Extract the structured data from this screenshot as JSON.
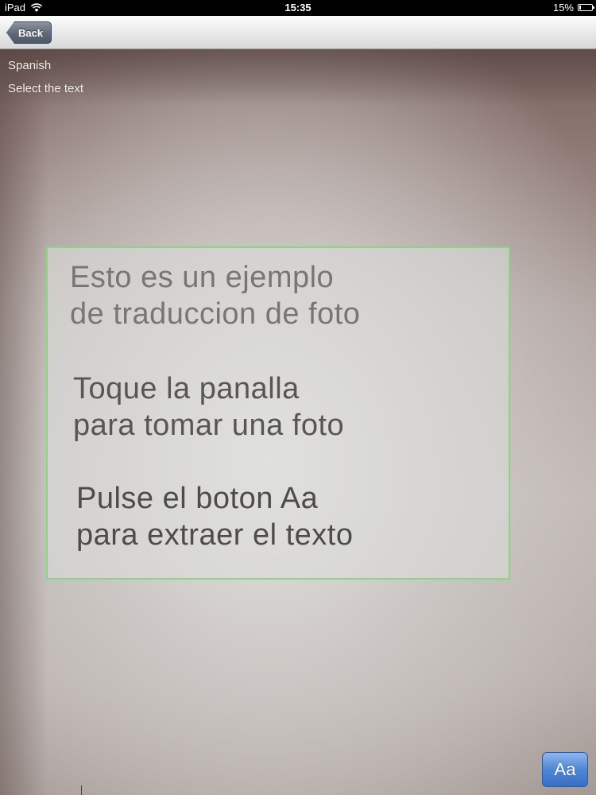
{
  "status_bar": {
    "carrier": "iPad",
    "time": "15:35",
    "battery_percent": "15%",
    "battery_level": 0.15,
    "wifi_icon": "wifi-icon"
  },
  "nav_bar": {
    "back_label": "Back"
  },
  "camera": {
    "language": "Spanish",
    "hint": "Select the text",
    "selection_color": "#86d682",
    "photo_text": {
      "paragraph_1": [
        "Esto es un ejemplo",
        "de traduccion de foto"
      ],
      "paragraph_2": [
        "Toque la panalla",
        "para tomar una foto"
      ],
      "paragraph_3": [
        "Pulse el boton Aa",
        "para extraer el texto"
      ]
    }
  },
  "toolbar": {
    "extract_label": "Aa",
    "accent": "#4f86d6"
  }
}
